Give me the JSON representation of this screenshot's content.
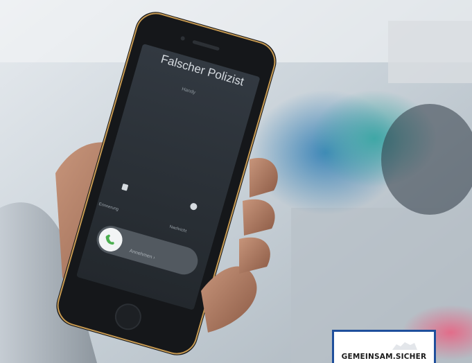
{
  "photo": {
    "description_icon": "photo-phone-icon",
    "colors": {
      "background": "#c9d2d9",
      "phone": "#1b1d20",
      "screen": "#2b3035",
      "accept": "#4caf50",
      "badge_border": "#1f4f9c"
    }
  },
  "phone_screen": {
    "caller_name": "Falscher Polizist",
    "caller_sub": "Handy",
    "option_left": "Erinnerung",
    "option_right": "Nachricht",
    "slide_text": "Annehmen ›"
  },
  "badge": {
    "text": "GEMEINSAM.SICHER"
  }
}
